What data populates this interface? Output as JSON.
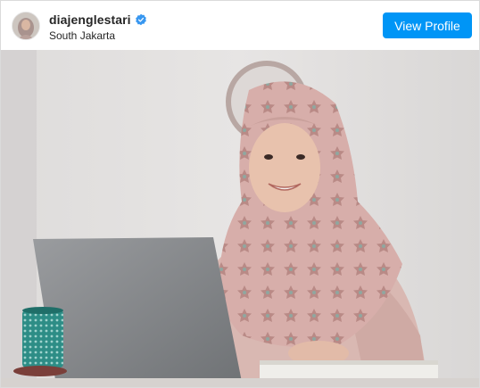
{
  "post": {
    "username": "diajenglestari",
    "location": "South Jakarta",
    "view_profile_label": "View Profile",
    "verified": true
  },
  "icons": {
    "verified": "verified-badge-icon"
  },
  "colors": {
    "accent": "#0095f6",
    "verified": "#3897f0",
    "text": "#262626"
  }
}
